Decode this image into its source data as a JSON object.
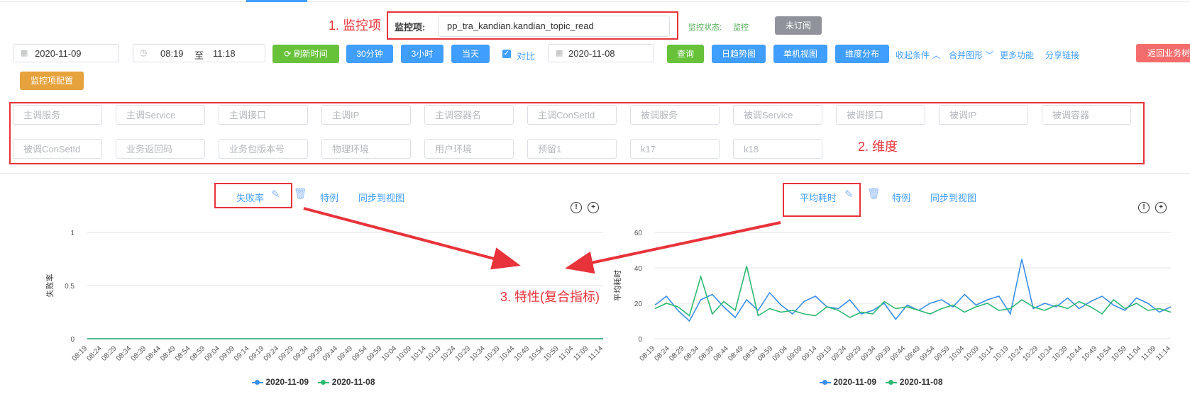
{
  "annotations": {
    "a1": "1. 监控项",
    "a2": "2. 维度",
    "a3": "3. 特性(复合指标)"
  },
  "toolbar": {
    "monitor_label": "监控项:",
    "monitor_value": "pp_tra_kandian.kandian_topic_read",
    "status_label": "监控状态:",
    "status_value": "监控",
    "unsubscribed": "未订阅",
    "date": "2020-11-09",
    "time_start": "08:19",
    "time_to": "至",
    "time_end": "11:18",
    "refresh": "刷新时间",
    "btn_30min": "30分钟",
    "btn_3h": "3小时",
    "btn_today": "当天",
    "compare_label": "对比",
    "compare_date": "2020-11-08",
    "query": "查询",
    "daily_trend": "日趋势图",
    "single_view": "单机视图",
    "dim_dist": "维度分布",
    "collapse": "收起条件",
    "merge": "合并图形",
    "more": "更多功能",
    "share": "分享链接",
    "back": "返回业务树",
    "config": "监控项配置"
  },
  "dimensions": {
    "row1": [
      "主调服务",
      "主调Service",
      "主调接口",
      "主调IP",
      "主调容器名",
      "主调ConSetId",
      "被调服务",
      "被调Service",
      "被调接口",
      "被调IP",
      "被调容器"
    ],
    "row2": [
      "被调ConSetId",
      "业务返回码",
      "业务包版本号",
      "物理环境",
      "用户环境",
      "预留1",
      "k17",
      "k18"
    ]
  },
  "chart_left_header": {
    "title": "失败率",
    "special": "特例",
    "sync": "同步到视图"
  },
  "chart_right_header": {
    "title": "平均耗时",
    "special": "特例",
    "sync": "同步到视图"
  },
  "chart_data": [
    {
      "type": "line",
      "title": "失败率",
      "ylabel": "失败率",
      "xlabel": "",
      "ylim": [
        0,
        1
      ],
      "yticks": [
        "0",
        "0.5",
        "1"
      ],
      "x": [
        "08:19",
        "08:24",
        "08:29",
        "08:34",
        "08:39",
        "08:44",
        "08:49",
        "08:54",
        "08:59",
        "09:04",
        "09:09",
        "09:14",
        "09:19",
        "09:24",
        "09:29",
        "09:34",
        "09:39",
        "09:44",
        "09:49",
        "09:54",
        "09:59",
        "10:04",
        "10:09",
        "10:14",
        "10:19",
        "10:24",
        "10:29",
        "10:34",
        "10:39",
        "10:44",
        "10:49",
        "10:54",
        "10:59",
        "11:04",
        "11:09",
        "11:14"
      ],
      "series": [
        {
          "name": "2020-11-09",
          "color": "#3a8ee6",
          "values": [
            0,
            0,
            0,
            0,
            0,
            0,
            0,
            0,
            0,
            0,
            0,
            0,
            0,
            0,
            0,
            0,
            0,
            0,
            0,
            0,
            0,
            0,
            0,
            0,
            0,
            0,
            0,
            0,
            0,
            0,
            0,
            0,
            0,
            0,
            0,
            0
          ]
        },
        {
          "name": "2020-11-08",
          "color": "#2eb872",
          "values": [
            0,
            0,
            0,
            0,
            0,
            0,
            0,
            0,
            0,
            0,
            0,
            0,
            0,
            0,
            0,
            0,
            0,
            0,
            0,
            0,
            0,
            0,
            0,
            0,
            0,
            0,
            0,
            0,
            0,
            0,
            0,
            0,
            0,
            0,
            0,
            0
          ]
        }
      ],
      "grid": true,
      "legend": "bottom"
    },
    {
      "type": "line",
      "title": "平均耗时",
      "ylabel": "平均耗时",
      "xlabel": "",
      "ylim": [
        0,
        60
      ],
      "yticks": [
        "0",
        "20",
        "40",
        "60"
      ],
      "x": [
        "08:19",
        "08:24",
        "08:29",
        "08:34",
        "08:39",
        "08:44",
        "08:49",
        "08:54",
        "08:59",
        "09:04",
        "09:09",
        "09:14",
        "09:19",
        "09:24",
        "09:29",
        "09:34",
        "09:39",
        "09:44",
        "09:49",
        "09:54",
        "09:59",
        "10:04",
        "10:09",
        "10:14",
        "10:19",
        "10:24",
        "10:29",
        "10:34",
        "10:39",
        "10:44",
        "10:49",
        "10:54",
        "10:59",
        "11:04",
        "11:09",
        "11:14"
      ],
      "series": [
        {
          "name": "2020-11-09",
          "color": "#3a8ee6",
          "values": [
            19,
            24,
            16,
            10,
            22,
            25,
            18,
            12,
            22,
            16,
            26,
            19,
            14,
            21,
            24,
            18,
            17,
            22,
            14,
            16,
            20,
            11,
            19,
            16,
            20,
            22,
            18,
            25,
            19,
            22,
            24,
            14,
            45,
            17,
            20,
            18,
            23,
            17,
            21,
            24,
            19,
            16,
            23,
            20,
            15,
            18
          ]
        },
        {
          "name": "2020-11-08",
          "color": "#2eb872",
          "values": [
            17,
            20,
            18,
            13,
            35,
            14,
            21,
            16,
            41,
            13,
            17,
            15,
            16,
            14,
            13,
            18,
            16,
            12,
            15,
            14,
            21,
            17,
            18,
            16,
            14,
            17,
            19,
            15,
            18,
            20,
            16,
            17,
            22,
            18,
            16,
            19,
            17,
            21,
            18,
            14,
            22,
            17,
            20,
            16,
            17,
            15
          ]
        }
      ],
      "grid": true,
      "legend": "bottom"
    }
  ]
}
